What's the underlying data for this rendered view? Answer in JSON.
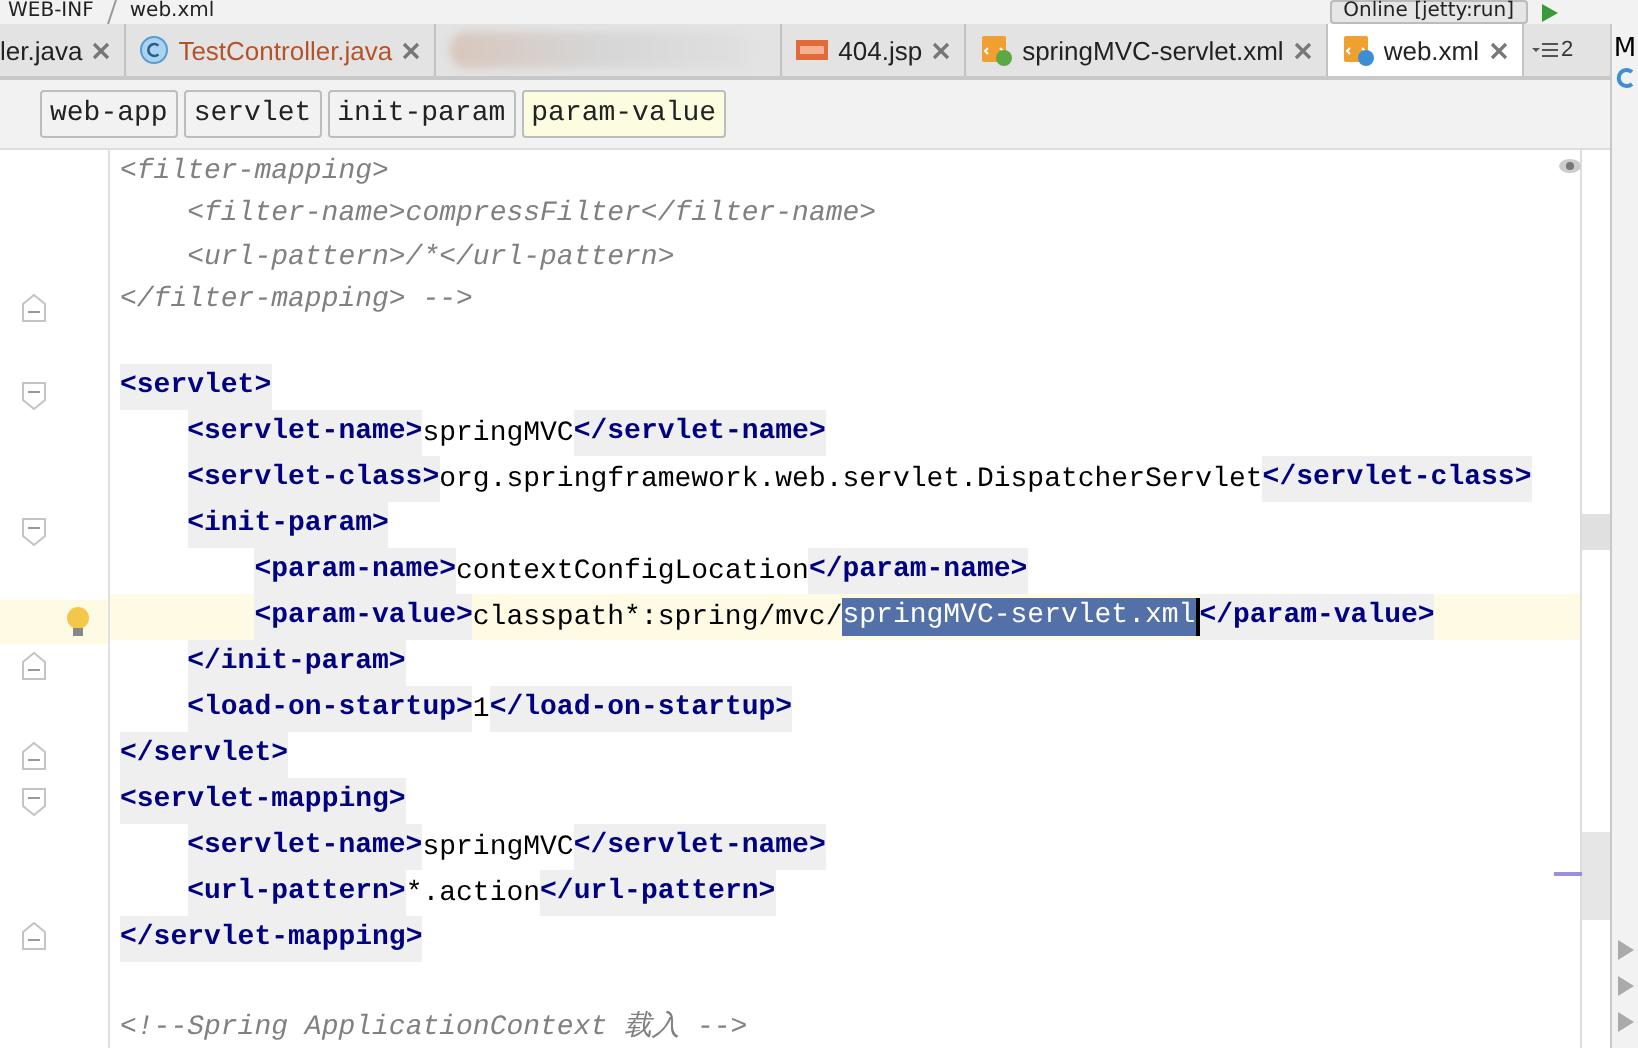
{
  "top_bar": {
    "path": [
      "WEB-INF",
      "web.xml"
    ],
    "run_config": "Online [jetty:run]"
  },
  "tabs": [
    {
      "kind": "java",
      "label": "ler.java",
      "selected": false
    },
    {
      "kind": "java-class",
      "label": "TestController.java",
      "color": "#b4532a",
      "selected": false
    },
    {
      "kind": "blurred",
      "selected": false
    },
    {
      "kind": "jsp",
      "label": "404.jsp",
      "selected": false
    },
    {
      "kind": "spring-xml",
      "label": "springMVC-servlet.xml",
      "selected": false
    },
    {
      "kind": "web-xml",
      "label": "web.xml",
      "selected": true
    }
  ],
  "hidden_tabs": "2",
  "side_panel": {
    "label": "M"
  },
  "breadcrumbs": [
    {
      "label": "web-app",
      "selected": false
    },
    {
      "label": "servlet",
      "selected": false
    },
    {
      "label": "init-param",
      "selected": false
    },
    {
      "label": "param-value",
      "selected": true
    }
  ],
  "lines": [
    {
      "kind": "code",
      "segments": [
        {
          "kind": "comment",
          "text": "<filter-mapping>"
        }
      ],
      "children": [
        {
          "kind": "code",
          "segments": [
            {
              "kind": "comment",
              "text": "<filter-name>compressFilter</filter-name>"
            }
          ]
        },
        {
          "kind": "code",
          "segments": [
            {
              "kind": "comment",
              "text": "<url-pattern>/*</url-pattern>"
            }
          ]
        }
      ]
    },
    {
      "kind": "code",
      "fold_end": true,
      "segments": [
        {
          "kind": "comment",
          "text": "</filter-mapping> -->"
        }
      ]
    },
    {
      "kind": "blank"
    },
    {
      "kind": "code",
      "fold_start": true,
      "segments": [
        {
          "kind": "tag",
          "text": "<servlet>"
        }
      ],
      "children": [
        {
          "kind": "code",
          "segments": [
            {
              "kind": "tag",
              "text": "<servlet-name>"
            },
            {
              "kind": "text",
              "text": "springMVC"
            },
            {
              "kind": "tag",
              "text": "</servlet-name>"
            }
          ]
        },
        {
          "kind": "code",
          "segments": [
            {
              "kind": "tag",
              "text": "<servlet-class>"
            },
            {
              "kind": "text",
              "text": "org.springframework.web.servlet.DispatcherServlet"
            },
            {
              "kind": "tag",
              "text": "</servlet-class>"
            }
          ]
        },
        {
          "kind": "code",
          "fold_start": true,
          "segments": [
            {
              "kind": "tag",
              "text": "<init-param>"
            }
          ],
          "children": [
            {
              "kind": "code",
              "segments": [
                {
                  "kind": "tag",
                  "text": "<param-name>"
                },
                {
                  "kind": "text",
                  "text": "contextConfigLocation"
                },
                {
                  "kind": "tag",
                  "text": "</param-name>"
                }
              ]
            },
            {
              "kind": "code",
              "current": true,
              "intention": true,
              "segments": [
                {
                  "kind": "tag",
                  "text": "<param-value>"
                },
                {
                  "kind": "text",
                  "text": "classpath*:spring/mvc/"
                },
                {
                  "kind": "selection",
                  "text": "springMVC-servlet.xml"
                },
                {
                  "kind": "caret"
                },
                {
                  "kind": "tag",
                  "text": "</param-value>"
                }
              ]
            }
          ]
        },
        {
          "kind": "code",
          "fold_end": true,
          "segments": [
            {
              "kind": "tag",
              "text": "</init-param>"
            }
          ]
        },
        {
          "kind": "code",
          "segments": [
            {
              "kind": "tag",
              "text": "<load-on-startup>"
            },
            {
              "kind": "text",
              "text": "1"
            },
            {
              "kind": "tag",
              "text": "</load-on-startup>"
            }
          ]
        }
      ]
    },
    {
      "kind": "code",
      "fold_end": true,
      "segments": [
        {
          "kind": "tag",
          "text": "</servlet>"
        }
      ]
    },
    {
      "kind": "code",
      "fold_start": true,
      "segments": [
        {
          "kind": "tag",
          "text": "<servlet-mapping>"
        }
      ],
      "children": [
        {
          "kind": "code",
          "segments": [
            {
              "kind": "tag",
              "text": "<servlet-name>"
            },
            {
              "kind": "text",
              "text": "springMVC"
            },
            {
              "kind": "tag",
              "text": "</servlet-name>"
            }
          ]
        },
        {
          "kind": "code",
          "segments": [
            {
              "kind": "tag",
              "text": "<url-pattern>"
            },
            {
              "kind": "text",
              "text": "*.action"
            },
            {
              "kind": "tag",
              "text": "</url-pattern>"
            }
          ]
        }
      ]
    },
    {
      "kind": "code",
      "fold_end": true,
      "segments": [
        {
          "kind": "tag",
          "text": "</servlet-mapping>"
        }
      ]
    },
    {
      "kind": "blank"
    },
    {
      "kind": "code",
      "segments": [
        {
          "kind": "comment",
          "text": "<!--Spring ApplicationContext 载入 -->"
        }
      ]
    }
  ]
}
